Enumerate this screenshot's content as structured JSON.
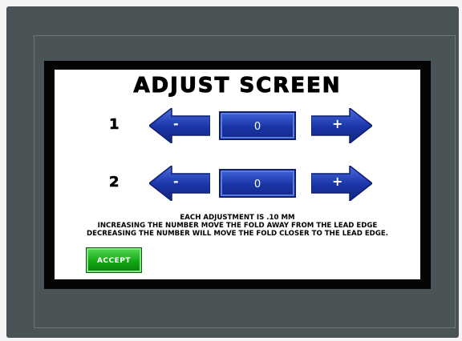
{
  "screen": {
    "title": "ADJUST SCREEN",
    "rows": [
      {
        "label": "1",
        "minus_label": "-",
        "value": "0",
        "plus_label": "+"
      },
      {
        "label": "2",
        "minus_label": "-",
        "value": "0",
        "plus_label": "+"
      }
    ],
    "info_lines": [
      "EACH ADJUSTMENT IS .10 MM",
      "INCREASING THE NUMBER MOVE THE FOLD AWAY FROM THE LEAD EDGE",
      "DECREASING THE NUMBER WILL MOVE THE FOLD CLOSER TO THE LEAD EDGE."
    ],
    "accept_label": "ACCEPT"
  },
  "colors": {
    "bezel": "#4a5356",
    "button_blue": "#1a34a6",
    "accept_green": "#14a814"
  }
}
